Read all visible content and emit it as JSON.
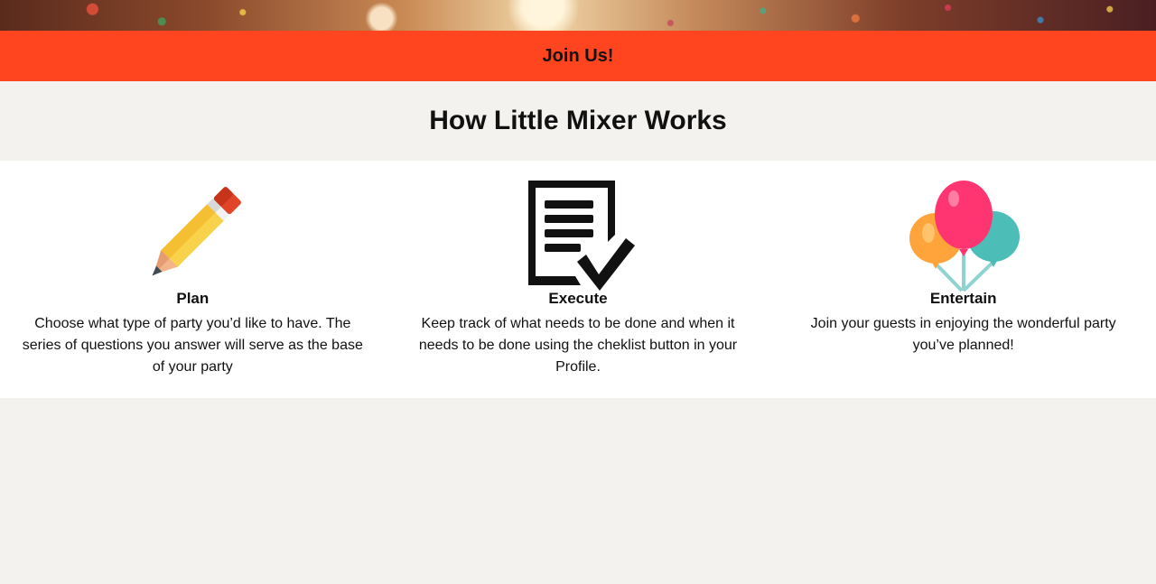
{
  "hero": {
    "image": "party-confetti-background"
  },
  "join": {
    "label": "Join Us!"
  },
  "how_it_works": {
    "title": "How Little Mixer Works",
    "steps": [
      {
        "icon": "pencil-icon",
        "title": "Plan",
        "description": "Choose what type of party you’d like to have. The series of questions you answer will serve as the base of your party"
      },
      {
        "icon": "checklist-icon",
        "title": "Execute",
        "description": "Keep track of what needs to be done and when it needs to be done using the cheklist button in your Profile."
      },
      {
        "icon": "balloons-icon",
        "title": "Entertain",
        "description": "Join your guests in enjoying the wonderful party you’ve planned!"
      }
    ]
  },
  "colors": {
    "accent": "#ff4520",
    "page_background": "#f3f2ee",
    "panel_background": "#ffffff"
  }
}
